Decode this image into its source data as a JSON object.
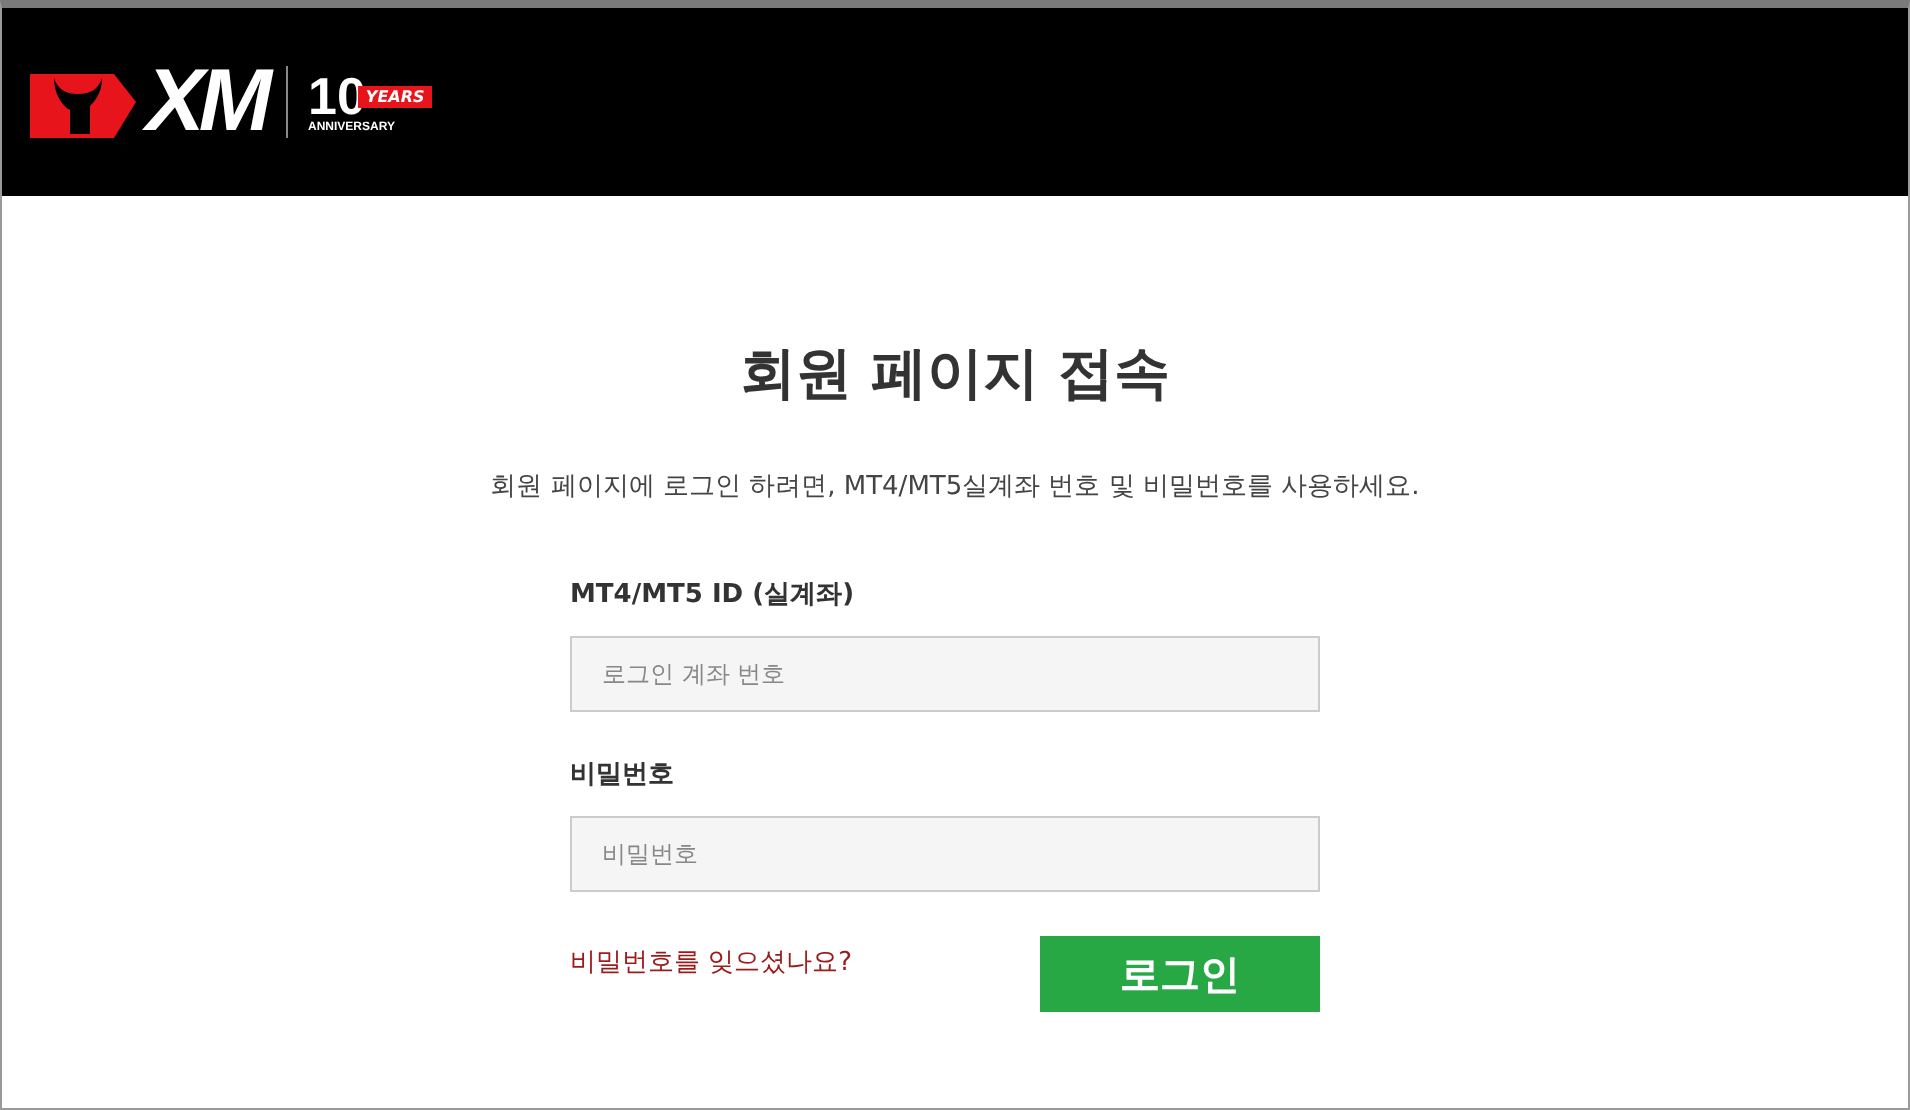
{
  "header": {
    "logo": {
      "wordmark": "XM",
      "anniversary_number": "10",
      "years": "YEARS",
      "anniversary": "ANNIVERSARY"
    }
  },
  "title": "회원 페이지 접속",
  "subtitle": "회원 페이지에 로그인 하려면, MT4/MT5실계좌 번호 및 비밀번호를 사용하세요.",
  "fields": [
    {
      "label": "MT4/MT5 ID (실계좌)",
      "placeholder": "로그인 계좌 번호"
    },
    {
      "label": "비밀번호",
      "placeholder": "비밀번호"
    }
  ],
  "forgot_link": "비밀번호를 잊으셨나요?",
  "login_button": "로그인"
}
